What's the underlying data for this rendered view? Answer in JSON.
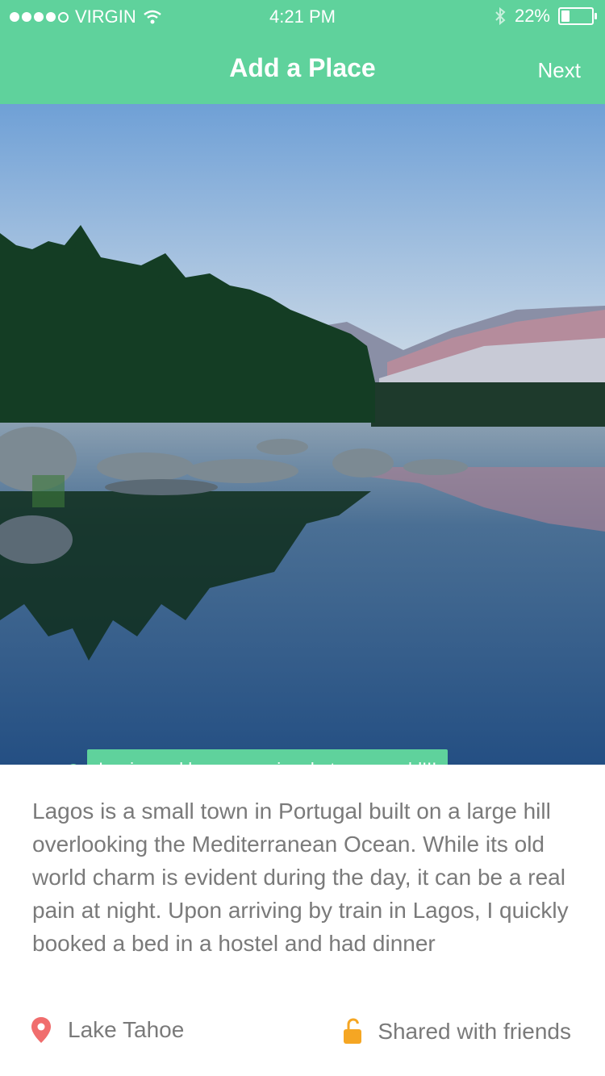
{
  "status_bar": {
    "carrier": "VIRGIN",
    "time": "4:21 PM",
    "battery": "22%",
    "signal_bars_filled": 4,
    "signal_bars_total": 5
  },
  "header": {
    "title": "Add a Place",
    "next_label": "Next"
  },
  "photo": {
    "caption": "I swimmed here, amazing, but super cold!!!"
  },
  "description": "Lagos is a small town in Portugal built on a large hill overlooking the Mediterranean Ocean. While its old world charm is evident during the day, it can be a real pain at night. Upon arriving by train in Lagos, I quickly booked a bed in a hostel and had dinner",
  "footer": {
    "location": "Lake Tahoe",
    "privacy": "Shared with friends",
    "location_icon": "map-pin-icon",
    "privacy_icon": "unlocked-padlock-icon"
  },
  "colors": {
    "accent": "#5fd29c",
    "text": "#7a7a7a",
    "pin": "#f06d6d",
    "lock": "#f5a623"
  }
}
